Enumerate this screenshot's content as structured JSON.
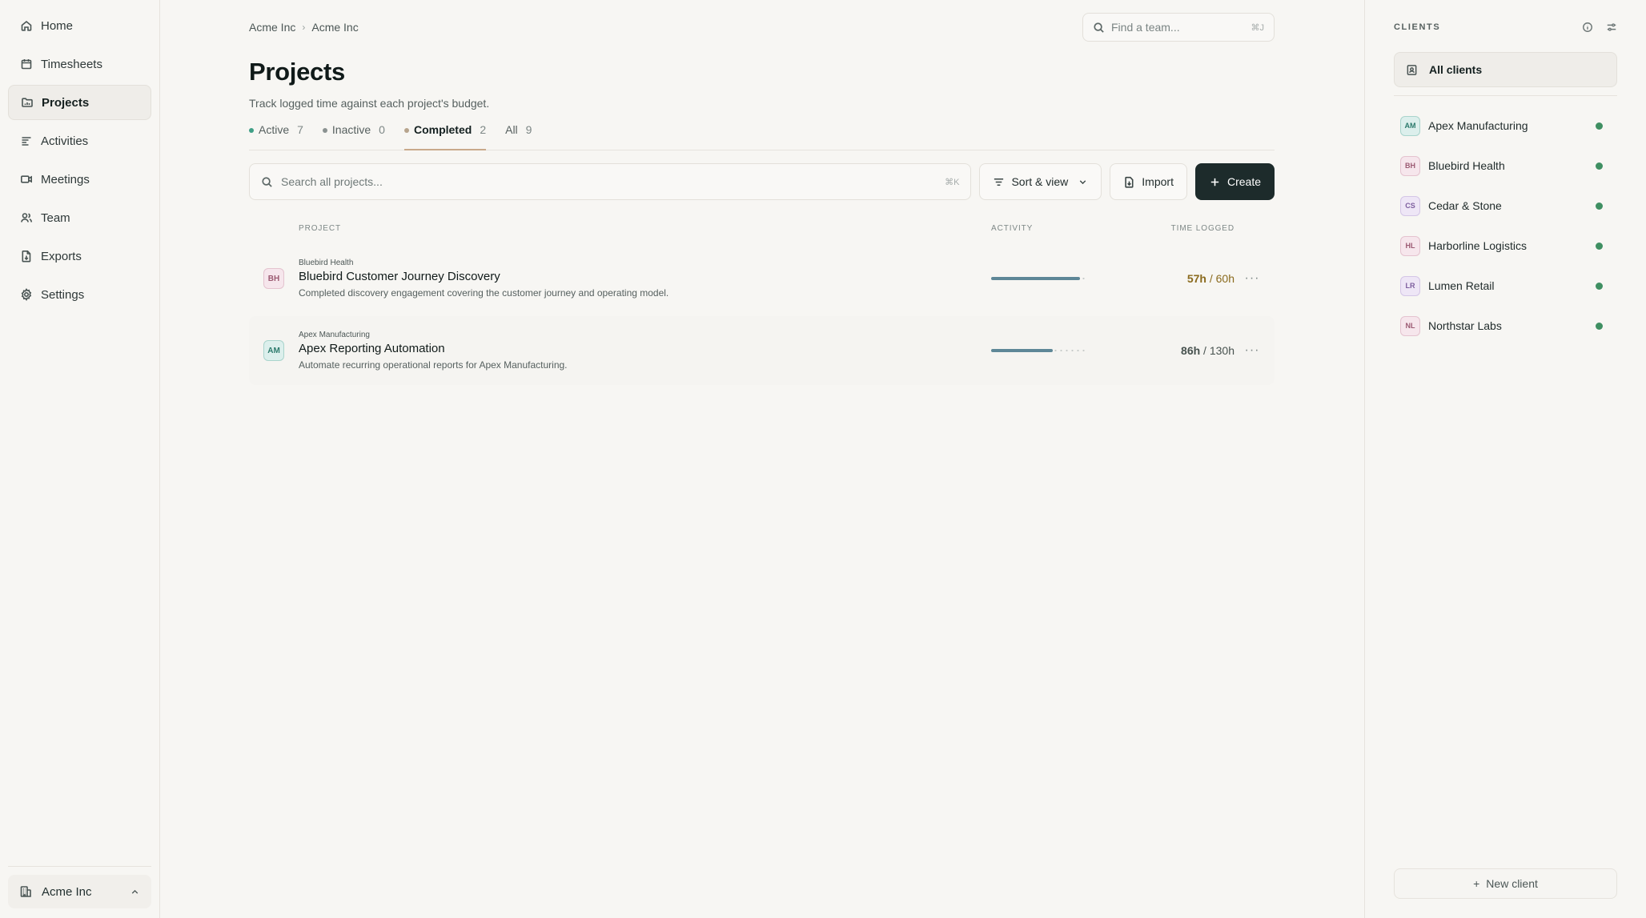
{
  "sidebar": {
    "items": [
      {
        "label": "Home",
        "icon": "home-icon"
      },
      {
        "label": "Timesheets",
        "icon": "calendar-icon"
      },
      {
        "label": "Projects",
        "icon": "folder-icon",
        "active": true
      },
      {
        "label": "Activities",
        "icon": "list-icon"
      },
      {
        "label": "Meetings",
        "icon": "video-icon"
      },
      {
        "label": "Team",
        "icon": "users-icon"
      },
      {
        "label": "Exports",
        "icon": "file-export-icon"
      },
      {
        "label": "Settings",
        "icon": "gear-icon"
      }
    ],
    "workspace": "Acme Inc"
  },
  "header": {
    "breadcrumb": [
      "Acme Inc",
      "Acme Inc"
    ],
    "team_search_placeholder": "Find a team...",
    "team_search_kbd": "⌘J"
  },
  "page": {
    "title": "Projects",
    "subtitle": "Track logged time against each project's budget."
  },
  "tabs": [
    {
      "label": "Active",
      "count": "7",
      "dot_color": "#3f9f86"
    },
    {
      "label": "Inactive",
      "count": "0",
      "dot_color": "#8a9291"
    },
    {
      "label": "Completed",
      "count": "2",
      "dot_color": "#b7a48d",
      "active": true
    },
    {
      "label": "All",
      "count": "9"
    }
  ],
  "toolbar": {
    "search_placeholder": "Search all projects...",
    "search_kbd": "⌘K",
    "sort_label": "Sort & view",
    "import_label": "Import",
    "create_label": "Create"
  },
  "table": {
    "headers": {
      "project": "PROJECT",
      "activity": "ACTIVITY",
      "time": "TIME LOGGED"
    },
    "rows": [
      {
        "initials": "BH",
        "client": "Bluebird Health",
        "name": "Bluebird Customer Journey Discovery",
        "description": "Completed discovery engagement covering the customer journey and operating model.",
        "logged": "57h",
        "budget": "60h",
        "progress": 0.95,
        "warn": true
      },
      {
        "initials": "AM",
        "client": "Apex Manufacturing",
        "name": "Apex Reporting Automation",
        "description": "Automate recurring operational reports for Apex Manufacturing.",
        "logged": "86h",
        "budget": "130h",
        "progress": 0.66,
        "warn": false
      }
    ]
  },
  "clients_panel": {
    "title": "CLIENTS",
    "all_label": "All clients",
    "clients": [
      {
        "initials": "AM",
        "name": "Apex Manufacturing",
        "color": "teal"
      },
      {
        "initials": "BH",
        "name": "Bluebird Health",
        "color": "pink"
      },
      {
        "initials": "CS",
        "name": "Cedar & Stone",
        "color": "violet"
      },
      {
        "initials": "HL",
        "name": "Harborline Logistics",
        "color": "pink"
      },
      {
        "initials": "LR",
        "name": "Lumen Retail",
        "color": "violet"
      },
      {
        "initials": "NL",
        "name": "Northstar Labs",
        "color": "pink"
      }
    ],
    "status_color": "#3f8f62",
    "new_client_label": "New client"
  }
}
